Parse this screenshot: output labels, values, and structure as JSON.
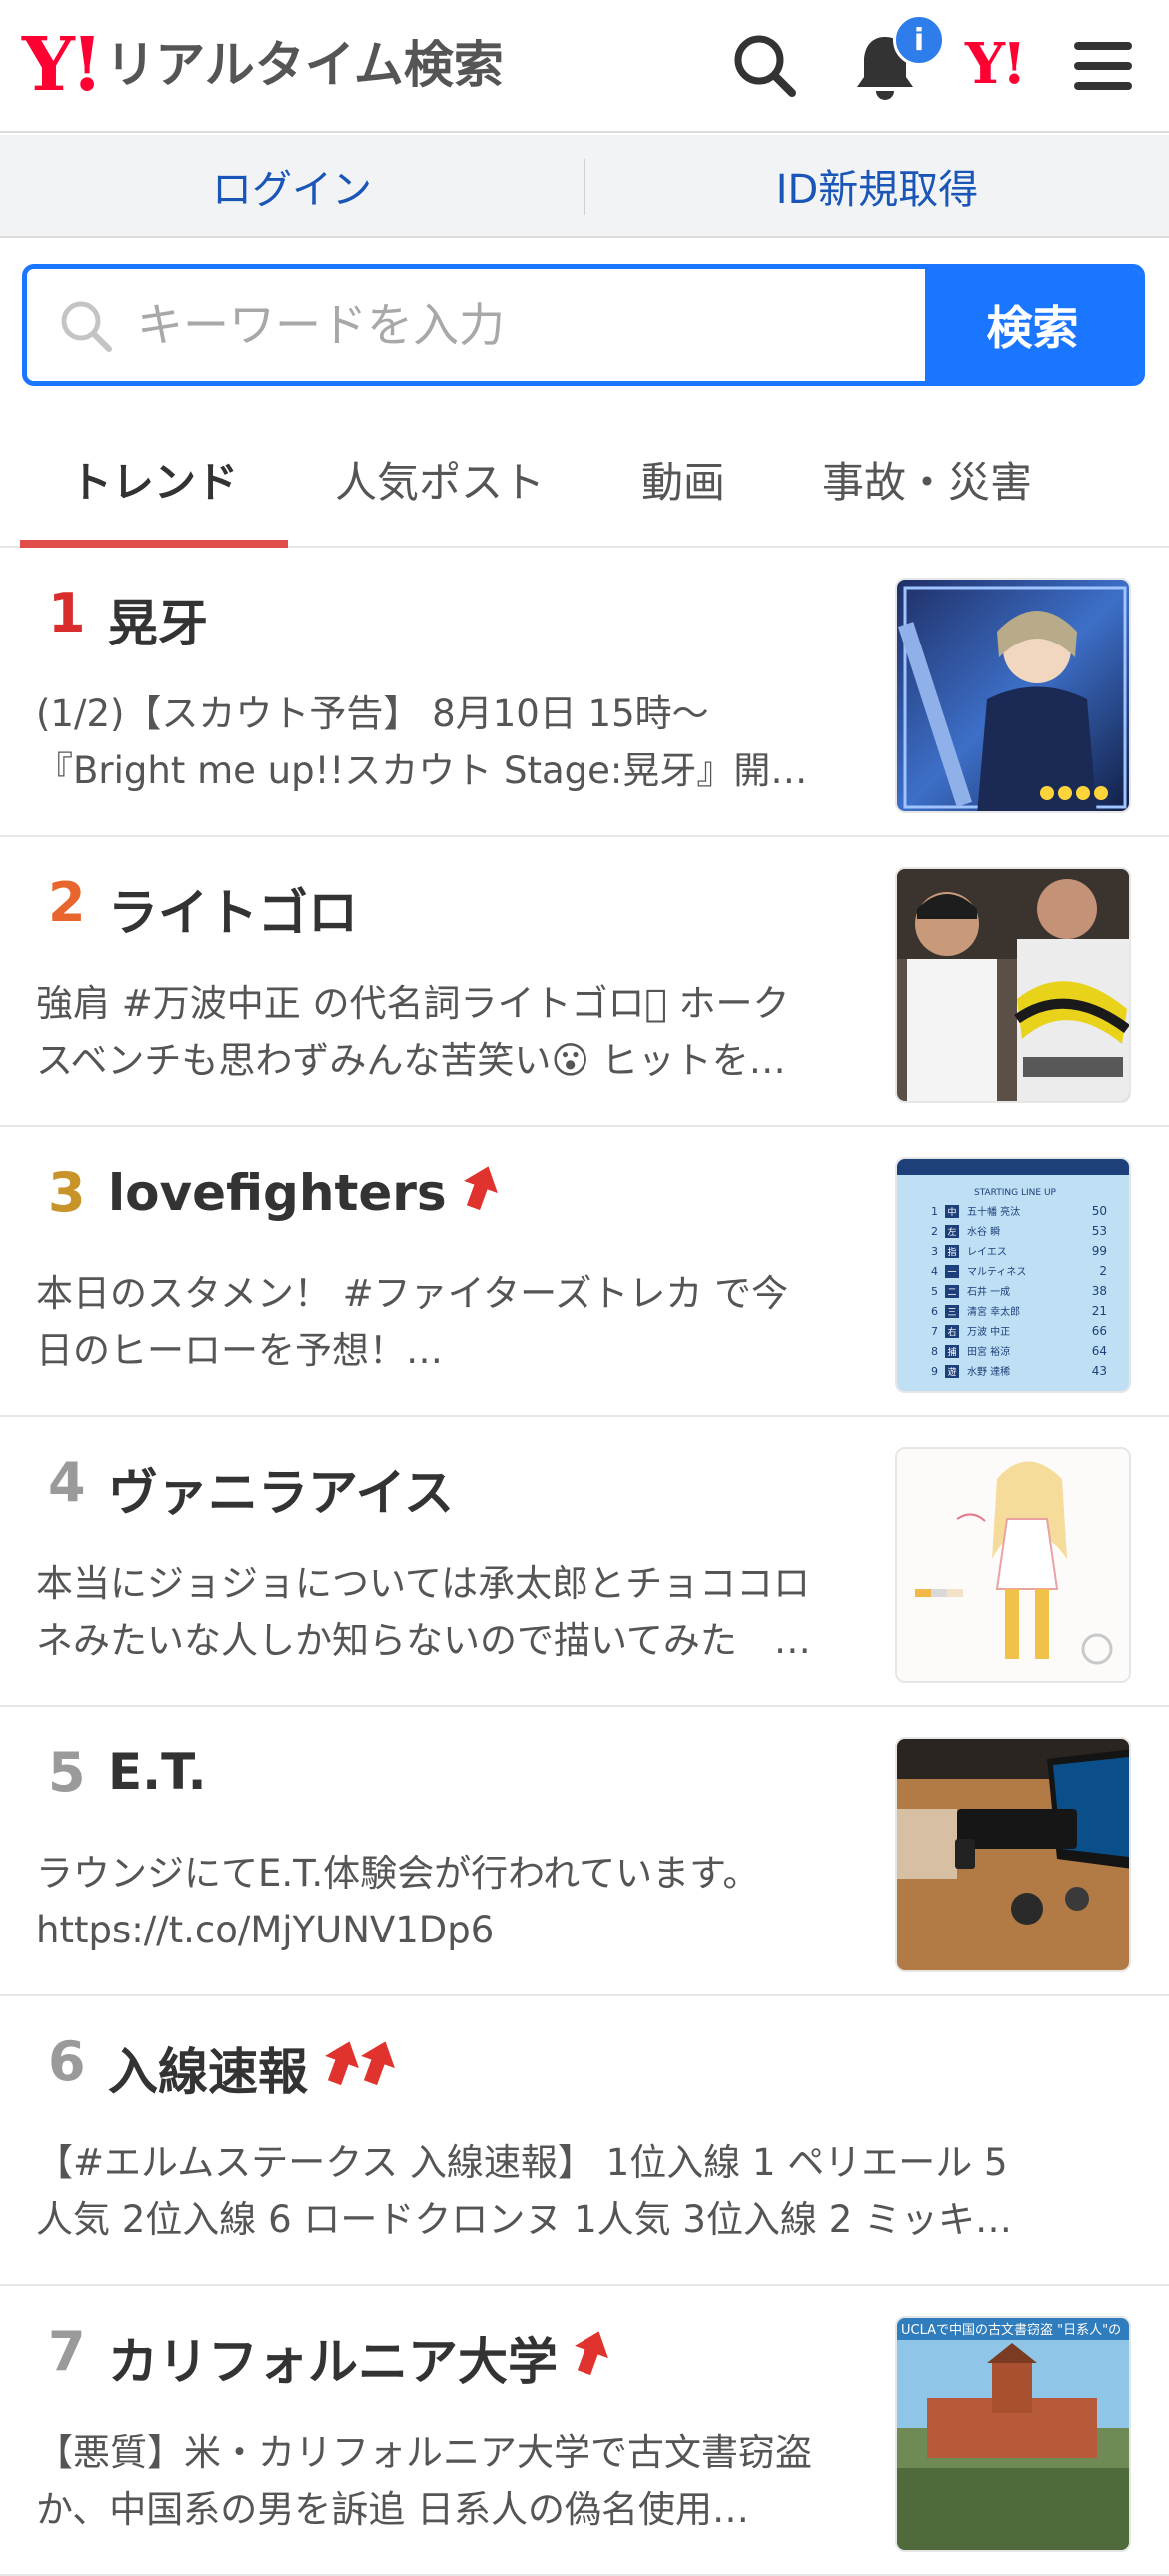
{
  "header": {
    "logo_mark": "Y!",
    "logo_text": "リアルタイム検索",
    "badge": "i",
    "yahoo_mark": "Y!"
  },
  "login_bar": {
    "login_label": "ログイン",
    "signup_label": "ID新規取得"
  },
  "search": {
    "placeholder": "キーワードを入力",
    "button_label": "検索"
  },
  "tabs": [
    {
      "label": "トレンド",
      "active": true
    },
    {
      "label": "人気ポスト",
      "active": false
    },
    {
      "label": "動画",
      "active": false
    },
    {
      "label": "事故・災害",
      "active": false
    }
  ],
  "trends": [
    {
      "rank": "1",
      "title": "晃牙",
      "trend": 0,
      "rank_color": "#d92d2d",
      "line1": "(1/2)【スカウト予告】 8月10日 15時〜",
      "line2": "『Bright me up!!スカウト Stage:晃牙』開…",
      "thumb": "anime-card-image"
    },
    {
      "rank": "2",
      "title": "ライトゴロ",
      "trend": 0,
      "rank_color": "#e8662e",
      "line1": "強肩 #万波中正 の代名詞ライトゴロ􁉡 ホーク",
      "line2": "スベンチも思わずみんな苦笑い😮 ヒットを…",
      "thumb": "baseball-bench-image"
    },
    {
      "rank": "3",
      "title": "lovefighters",
      "trend": 1,
      "rank_color": "#c89328",
      "line1": "本日のスタメン！ #ファイターズトレカ で今",
      "line2": "日のヒーローを予想！…",
      "thumb": "lineup-card-image"
    },
    {
      "rank": "4",
      "title": "ヴァニラアイス",
      "trend": 0,
      "rank_color": "#9a9a9a",
      "line1": "本当にジョジョについては承太郎とチョココロ",
      "line2": "ネみたいな人しか知らないので描いてみた　…",
      "thumb": "illustration-image"
    },
    {
      "rank": "5",
      "title": "E.T.",
      "trend": 0,
      "rank_color": "#9a9a9a",
      "line1": "ラウンジにてE.T.体験会が行われています。",
      "line2": "https://t.co/MjYUNV1Dp6",
      "thumb": "game-console-image"
    },
    {
      "rank": "6",
      "title": "入線速報",
      "trend": 2,
      "rank_color": "#9a9a9a",
      "line1": "【#エルムステークス 入線速報】 1位入線 1 ペリエール 5",
      "line2": "人気 2位入線 6 ロードクロンヌ 1人気 3位入線 2 ミッキ…",
      "thumb": ""
    },
    {
      "rank": "7",
      "title": "カリフォルニア大学",
      "trend": 1,
      "rank_color": "#9a9a9a",
      "line1": "【悪質】米・カリフォルニア大学で古文書窃盗",
      "line2": "か、中国系の男を訴追 日系人の偽名使用…",
      "thumb": "news-campus-image",
      "thumb_caption": "UCLAで中国の古文書窃盗 \"日系人\"の"
    }
  ],
  "lineup_card": {
    "header": "STARTING LINE UP",
    "players": [
      {
        "num": "1",
        "pos": "中",
        "name": "五十幡 亮汰",
        "no": "50"
      },
      {
        "num": "2",
        "pos": "左",
        "name": "水谷 瞬",
        "no": "53"
      },
      {
        "num": "3",
        "pos": "指",
        "name": "レイエス",
        "no": "99"
      },
      {
        "num": "4",
        "pos": "一",
        "name": "マルティネス",
        "no": "2"
      },
      {
        "num": "5",
        "pos": "二",
        "name": "石井 一成",
        "no": "38"
      },
      {
        "num": "6",
        "pos": "三",
        "name": "清宮 幸太郎",
        "no": "21"
      },
      {
        "num": "7",
        "pos": "右",
        "name": "万波 中正",
        "no": "66"
      },
      {
        "num": "8",
        "pos": "捕",
        "name": "田宮 裕涼",
        "no": "64"
      },
      {
        "num": "9",
        "pos": "遊",
        "name": "水野 達稀",
        "no": "43"
      }
    ]
  },
  "colors": {
    "accent": "#1a75ff",
    "link": "#1a55b8",
    "brand": "#ff0033",
    "tab_underline": "#e04b4b",
    "up_arrow": "#e0332e"
  }
}
